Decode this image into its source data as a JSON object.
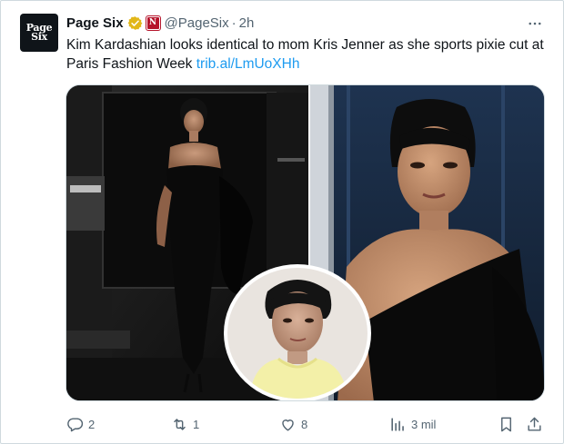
{
  "author": {
    "avatar_text_line1": "Page",
    "avatar_text_line2": "Six",
    "name": "Page Six",
    "handle": "@PageSix",
    "separator": "·",
    "time": "2h",
    "affiliate_badge_text": "N"
  },
  "tweet": {
    "text": "Kim Kardashian looks identical to mom Kris Jenner as she sports pixie cut at Paris Fashion Week",
    "link": "trib.al/LmUoXHh"
  },
  "actions": {
    "replies": "2",
    "retweets": "1",
    "likes": "8",
    "views": "3 mil"
  },
  "colors": {
    "accent": "#1d9bf0",
    "text_primary": "#0f1419",
    "text_secondary": "#536471",
    "verified_gold": "#e2b719",
    "affiliate_red": "#b5132a"
  },
  "icons": [
    "verified-badge-icon",
    "affiliate-badge-icon",
    "more-icon",
    "reply-icon",
    "retweet-icon",
    "like-icon",
    "views-icon",
    "bookmark-icon",
    "share-icon"
  ]
}
